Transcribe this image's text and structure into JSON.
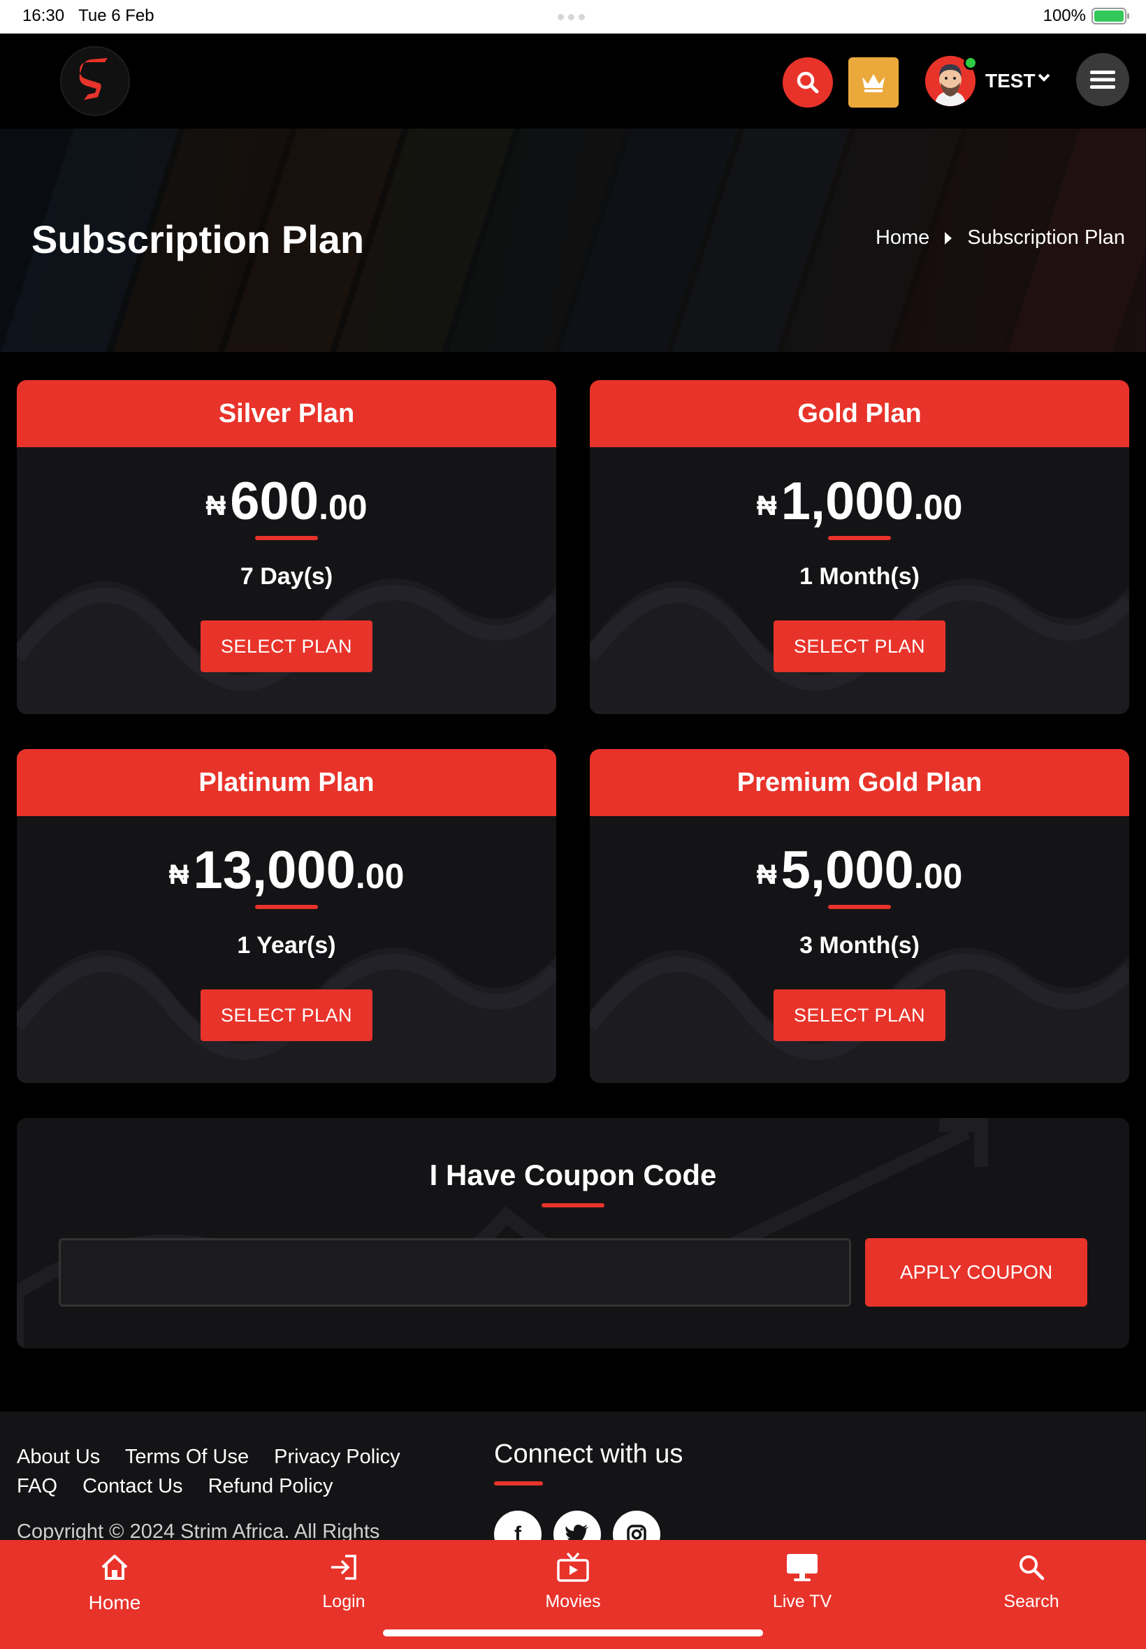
{
  "status_bar": {
    "time": "16:30",
    "date": "Tue 6 Feb",
    "battery": "100%"
  },
  "header": {
    "logo_letter": "S",
    "user_name": "TEST"
  },
  "hero": {
    "title": "Subscription Plan",
    "breadcrumb": [
      "Home",
      "Subscription Plan"
    ]
  },
  "plans": [
    {
      "name": "Silver Plan",
      "currency": "₦",
      "amount": "600",
      "decimals": ".00",
      "duration": "7 Day(s)",
      "button": "SELECT PLAN"
    },
    {
      "name": "Gold Plan",
      "currency": "₦",
      "amount": "1,000",
      "decimals": ".00",
      "duration": "1 Month(s)",
      "button": "SELECT PLAN"
    },
    {
      "name": "Platinum Plan",
      "currency": "₦",
      "amount": "13,000",
      "decimals": ".00",
      "duration": "1 Year(s)",
      "button": "SELECT PLAN"
    },
    {
      "name": "Premium Gold Plan",
      "currency": "₦",
      "amount": "5,000",
      "decimals": ".00",
      "duration": "3 Month(s)",
      "button": "SELECT PLAN"
    }
  ],
  "coupon": {
    "title": "I Have Coupon Code",
    "input_value": "",
    "button": "APPLY COUPON"
  },
  "footer": {
    "links": [
      "About Us",
      "Terms Of Use",
      "Privacy Policy",
      "FAQ",
      "Contact Us",
      "Refund Policy"
    ],
    "copyright": "Copyright © 2024 Strim Africa. All Rights",
    "connect_title": "Connect with us",
    "social_icons": [
      "facebook-icon",
      "twitter-icon",
      "instagram-icon"
    ]
  },
  "tabbar": {
    "items": [
      {
        "label": "Home",
        "icon": "home-icon",
        "active": true
      },
      {
        "label": "Login",
        "icon": "login-icon",
        "active": false
      },
      {
        "label": "Movies",
        "icon": "movies-icon",
        "active": false
      },
      {
        "label": "Live TV",
        "icon": "live-tv-icon",
        "active": false
      },
      {
        "label": "Search",
        "icon": "search-icon",
        "active": false
      }
    ]
  },
  "colors": {
    "accent": "#e8332a",
    "crown_button": "#eba93c",
    "card_bg": "#141416",
    "page_bg": "#000000"
  }
}
